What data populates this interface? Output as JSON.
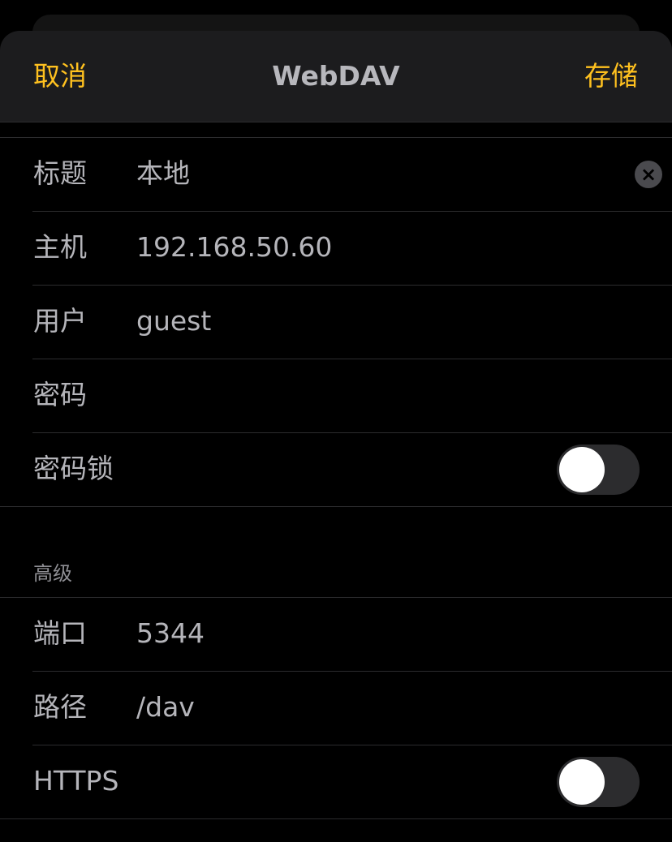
{
  "nav": {
    "cancel_label": "取消",
    "title": "WebDAV",
    "save_label": "存储"
  },
  "basic": {
    "title_label": "标题",
    "title_value": "本地",
    "host_label": "主机",
    "host_value": "192.168.50.60",
    "user_label": "用户",
    "user_value": "guest",
    "password_label": "密码",
    "password_value": "",
    "passcode_lock_label": "密码锁",
    "passcode_lock_on": false
  },
  "advanced": {
    "header": "高级",
    "port_label": "端口",
    "port_value": "5344",
    "path_label": "路径",
    "path_value": "/dav",
    "https_label": "HTTPS",
    "https_on": false
  },
  "colors": {
    "accent": "#ffc11f",
    "background": "#000000",
    "nav_background": "#1c1c1e",
    "separator": "#2c2c2e"
  },
  "icons": {
    "clear": "clear-icon"
  }
}
